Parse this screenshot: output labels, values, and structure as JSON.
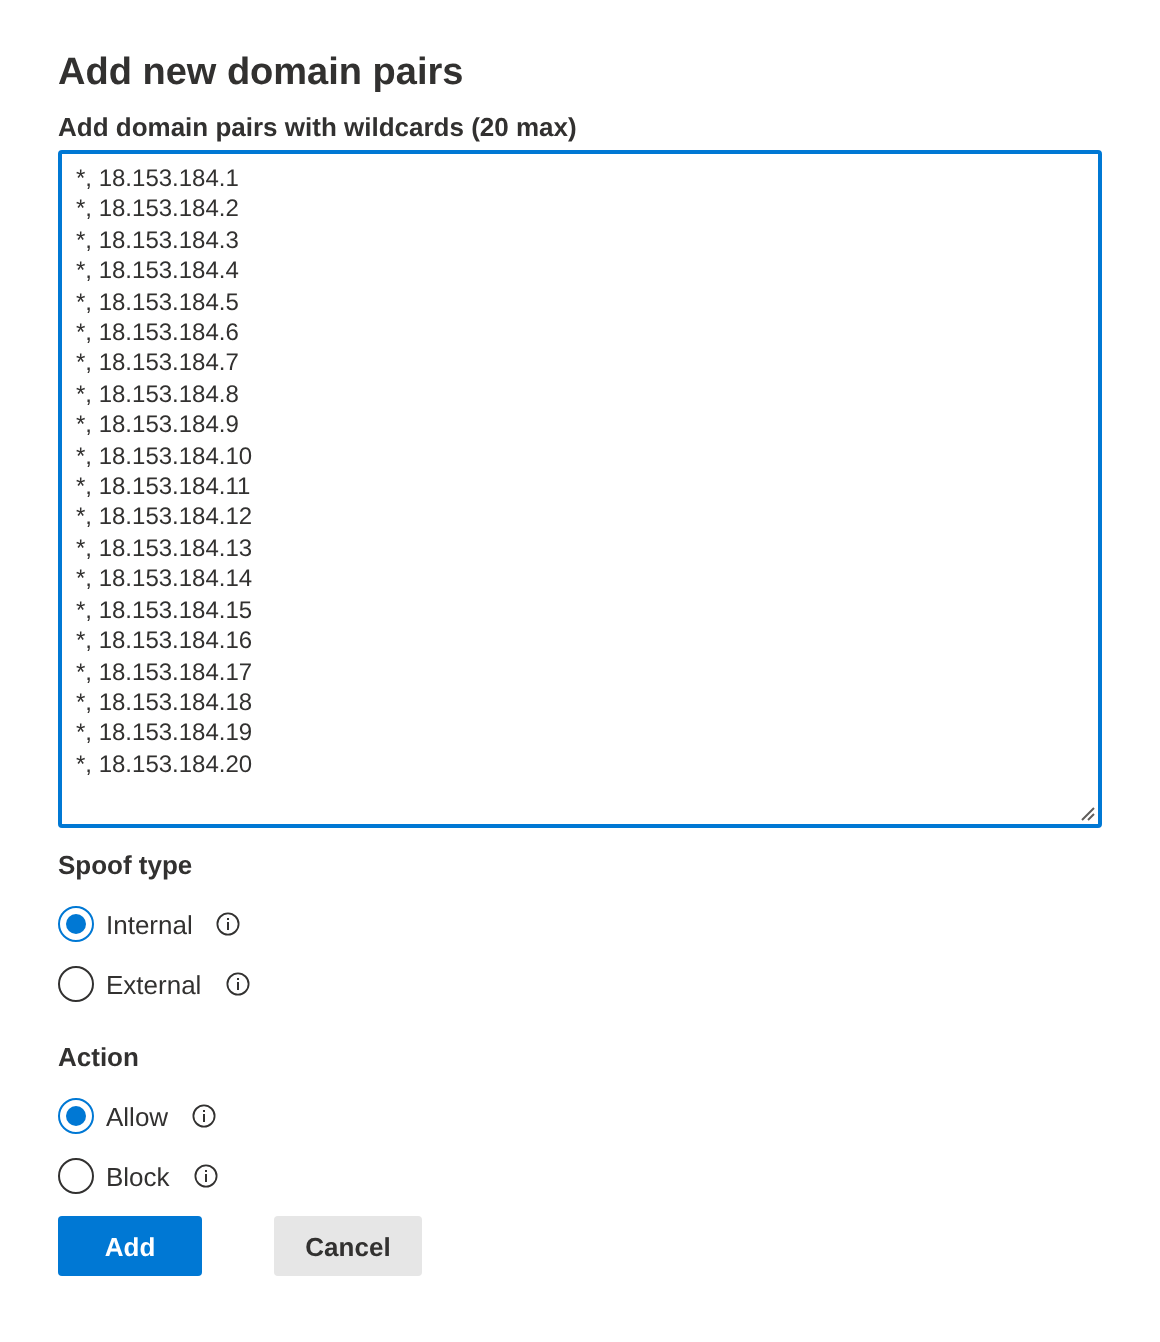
{
  "dialog": {
    "title": "Add new domain pairs"
  },
  "domain_pairs": {
    "label": "Add domain pairs with wildcards (20 max)",
    "focused": true,
    "lines": [
      "*, 18.153.184.1",
      "*, 18.153.184.2",
      "*, 18.153.184.3",
      "*, 18.153.184.4",
      "*, 18.153.184.5",
      "*, 18.153.184.6",
      "*, 18.153.184.7",
      "*, 18.153.184.8",
      "*, 18.153.184.9",
      "*, 18.153.184.10",
      "*, 18.153.184.11",
      "*, 18.153.184.12",
      "*, 18.153.184.13",
      "*, 18.153.184.14",
      "*, 18.153.184.15",
      "*, 18.153.184.16",
      "*, 18.153.184.17",
      "*, 18.153.184.18",
      "*, 18.153.184.19",
      "*, 18.153.184.20"
    ]
  },
  "radio_groups": [
    {
      "label": "Spoof type",
      "options": [
        {
          "label": "Internal",
          "selected": true
        },
        {
          "label": "External",
          "selected": false
        }
      ]
    },
    {
      "label": "Action",
      "options": [
        {
          "label": "Allow",
          "selected": true
        },
        {
          "label": "Block",
          "selected": false
        }
      ]
    }
  ],
  "buttons": [
    {
      "label": "Add",
      "kind": "primary"
    },
    {
      "label": "Cancel",
      "kind": "secondary"
    }
  ]
}
